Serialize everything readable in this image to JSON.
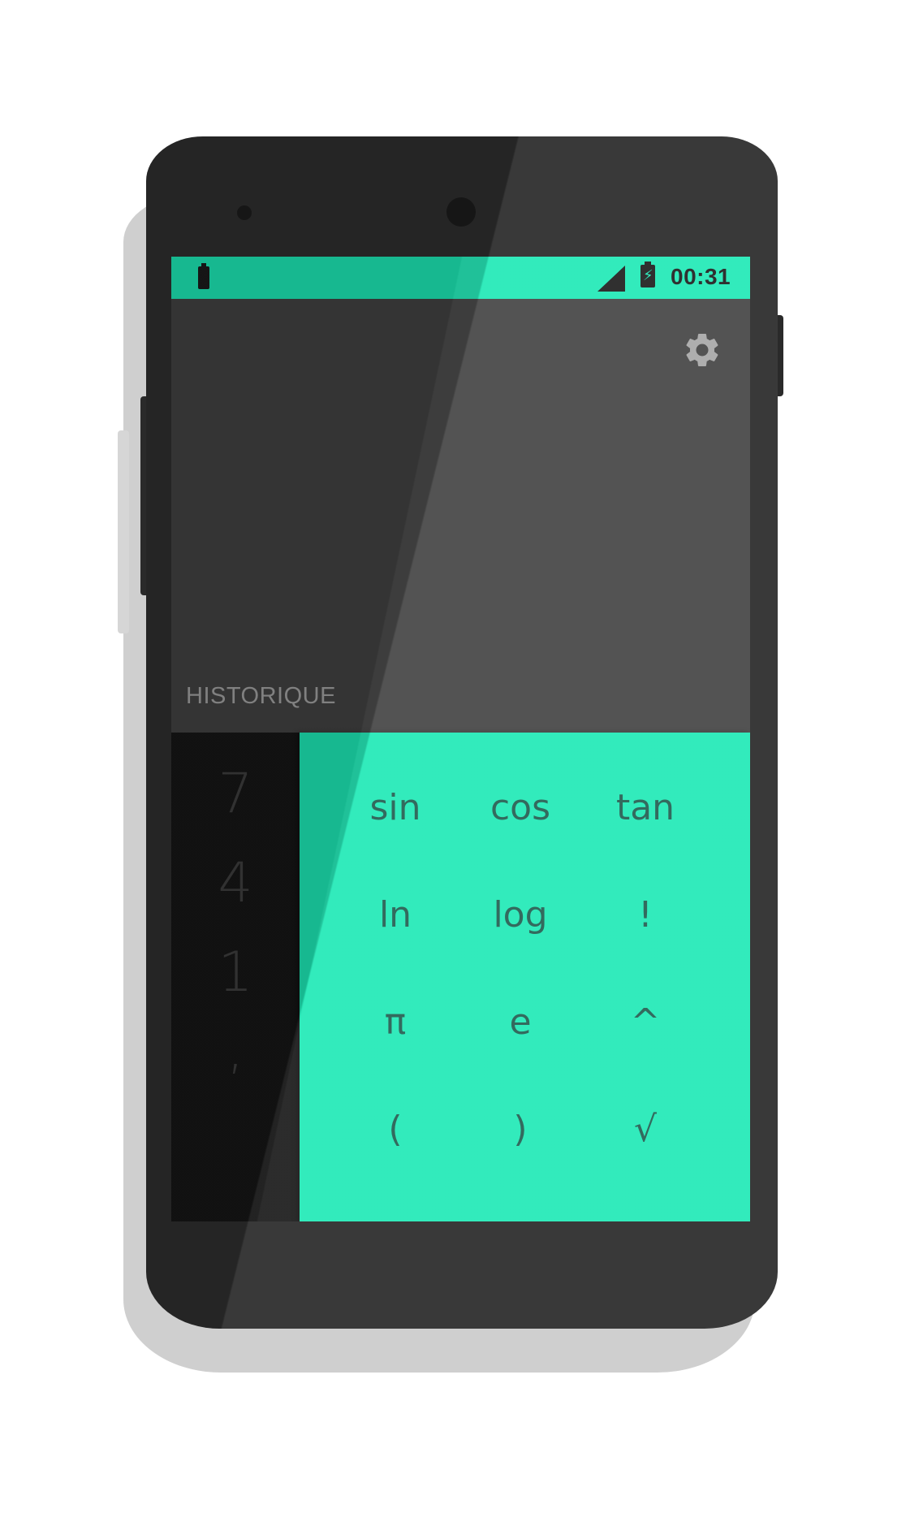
{
  "status_bar": {
    "time": "00:31",
    "icons": [
      "battery-icon",
      "signal-icon",
      "battery-charging-icon"
    ],
    "bolt_glyph": "⚡",
    "color": "#1de9b6"
  },
  "display": {
    "history_label": "HISTORIQUE",
    "settings_icon": "gear-icon"
  },
  "numpad": {
    "keys": [
      "7",
      "4",
      "1",
      ","
    ]
  },
  "advanced_pad": {
    "keys": [
      "sin",
      "cos",
      "tan",
      "ln",
      "log",
      "!",
      "π",
      "e",
      "^",
      "(",
      ")",
      "√"
    ]
  },
  "colors": {
    "accent": "#1de9b6",
    "display_bg": "#424242",
    "numpad_bg": "#161616",
    "device_body": "#2d2d2d"
  }
}
